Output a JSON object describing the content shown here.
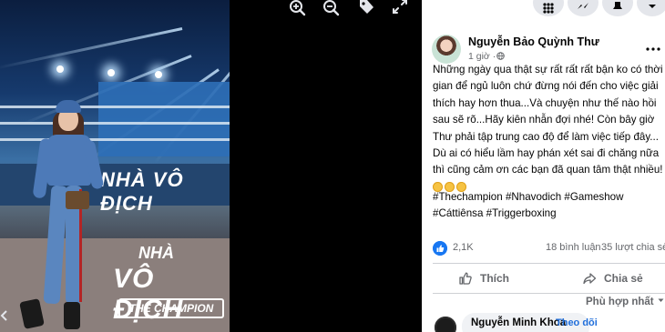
{
  "post": {
    "author": "Nguyễn Bảo Quỳnh Thư",
    "timestamp": "1 giờ ·",
    "more_icon": "more-horizontal-icon",
    "body_lines": [
      "Những ngày qua thật sự rất rất rất bận ko có thời",
      "gian để ngủ luôn chứ đừng nói đến cho việc giải",
      "thích hay hơn thua...Và chuyện như thế nào hồi",
      "sau sẽ rõ...Hãy kiên nhẫn đợi nhé! Còn bây giờ",
      "Thư phải tập trung cao độ để làm việc tiếp đây...",
      "Dù ai có hiểu lầm hay phán xét sai đi chăng nữa",
      "thì cũng cảm ơn các bạn đã quan tâm thật nhiều!"
    ],
    "emoji_count": 3,
    "hashtags": [
      "#Thechampion",
      "#Nhavodich",
      "#Gameshow",
      "#Cáttiênsa",
      "#Triggerboxing"
    ]
  },
  "stats": {
    "likes": "2,1K",
    "comments": "18 bình luận",
    "shares": "35 lượt chia sẻ"
  },
  "actions": {
    "like_label": "Thích",
    "share_label": "Chia sẻ"
  },
  "comments": {
    "sort_label": "Phù hợp nhất",
    "first_commenter": "Nguyễn Minh Khoa",
    "follow_label": "Theo dõi",
    "separator": "·"
  },
  "photo": {
    "banner_text": "NHÀ VÔ ĐỊCH",
    "logo_line1": "NHÀ",
    "logo_line2": "VÔ ĐỊCH",
    "logo_line3": "THE CHAMPION"
  },
  "icons": {
    "zoom_in": "zoom-in-icon",
    "zoom_out": "zoom-out-icon",
    "tag": "tag-icon",
    "fullscreen": "fullscreen-icon",
    "like": "thumbs-up-icon",
    "share": "share-arrow-icon",
    "privacy": "globe-icon"
  },
  "colors": {
    "facebook_blue": "#1877f2",
    "link_blue": "#216fdb",
    "secondary_text": "#65676b",
    "divider": "#ced0d4"
  }
}
